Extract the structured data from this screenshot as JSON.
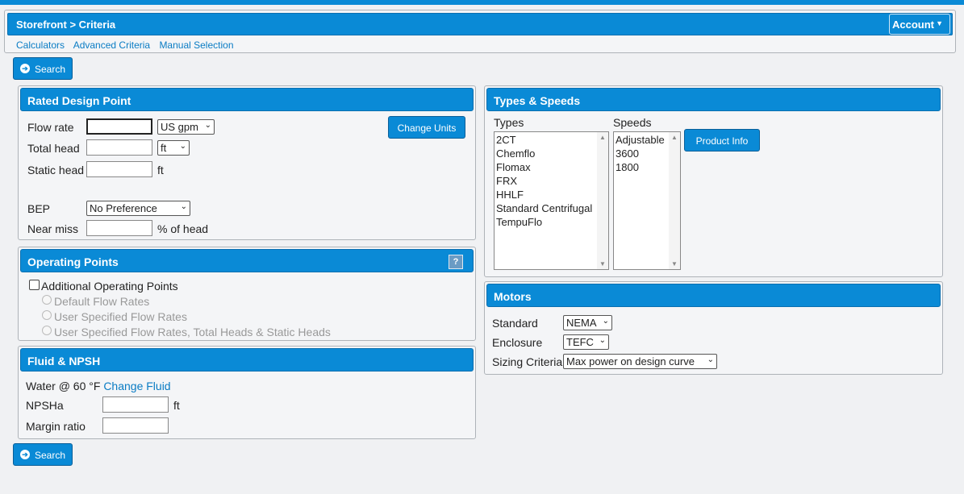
{
  "nav": {
    "breadcrumb": "Storefront > Criteria",
    "account_label": "Account",
    "links": [
      "Calculators",
      "Advanced Criteria",
      "Manual Selection"
    ]
  },
  "search_label": "Search",
  "rated": {
    "title": "Rated Design Point",
    "flow_rate_label": "Flow rate",
    "flow_rate_unit": "US gpm",
    "total_head_label": "Total head",
    "total_head_unit": "ft",
    "static_head_label": "Static head",
    "static_head_unit": "ft",
    "bep_label": "BEP",
    "bep_value": "No Preference",
    "near_miss_label": "Near miss",
    "near_miss_unit": "% of head",
    "change_units_label": "Change Units"
  },
  "operating": {
    "title": "Operating Points",
    "help": "?",
    "additional_label": "Additional Operating Points",
    "options": [
      "Default Flow Rates",
      "User Specified Flow Rates",
      "User Specified Flow Rates, Total Heads & Static Heads"
    ]
  },
  "fluid": {
    "title": "Fluid & NPSH",
    "fluid_text": "Water @ 60 °F",
    "change_fluid": "Change Fluid",
    "npsha_label": "NPSHa",
    "npsha_unit": "ft",
    "margin_label": "Margin ratio"
  },
  "types": {
    "title": "Types & Speeds",
    "types_label": "Types",
    "types_list": [
      "2CT",
      "Chemflo",
      "Flomax",
      "FRX",
      "HHLF",
      "Standard Centrifugal",
      "TempuFlo"
    ],
    "speeds_label": "Speeds",
    "speeds_list": [
      "Adjustable",
      "3600",
      "1800"
    ],
    "product_info_label": "Product Info"
  },
  "motors": {
    "title": "Motors",
    "standard_label": "Standard",
    "standard_value": "NEMA",
    "enclosure_label": "Enclosure",
    "enclosure_value": "TEFC",
    "sizing_label": "Sizing Criteria",
    "sizing_value": "Max power on design curve"
  }
}
